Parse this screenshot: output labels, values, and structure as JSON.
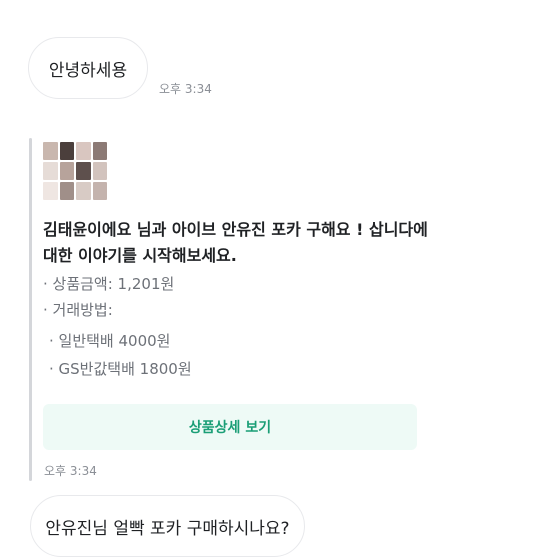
{
  "messages": {
    "greeting": {
      "text": "안녕하세용",
      "time": "오후 3:34"
    },
    "product_card": {
      "title": "김태윤이에요 님과 아이브 안유진 포카 구해요 ! 삽니다에 대한 이야기를 시작해보세요.",
      "price_line": "· 상품금액: 1,201원",
      "delivery_label": "· 거래방법:",
      "delivery_options": [
        "· 일반택배 4000원",
        "· GS반값택배 1800원"
      ],
      "detail_button": "상품상세 보기",
      "time": "오후 3:34",
      "thumbnail_colors": [
        "#c9b7ae",
        "#4b3f3c",
        "#d9c6c0",
        "#8c7a75",
        "#e6dcd7",
        "#b7a39b",
        "#5e504d",
        "#d2c3bd",
        "#efe6e2",
        "#a08f89",
        "#d8cbc5",
        "#c4b3ad"
      ]
    },
    "reply": {
      "text": "안유진님 얼빡 포카 구매하시나요?"
    }
  }
}
